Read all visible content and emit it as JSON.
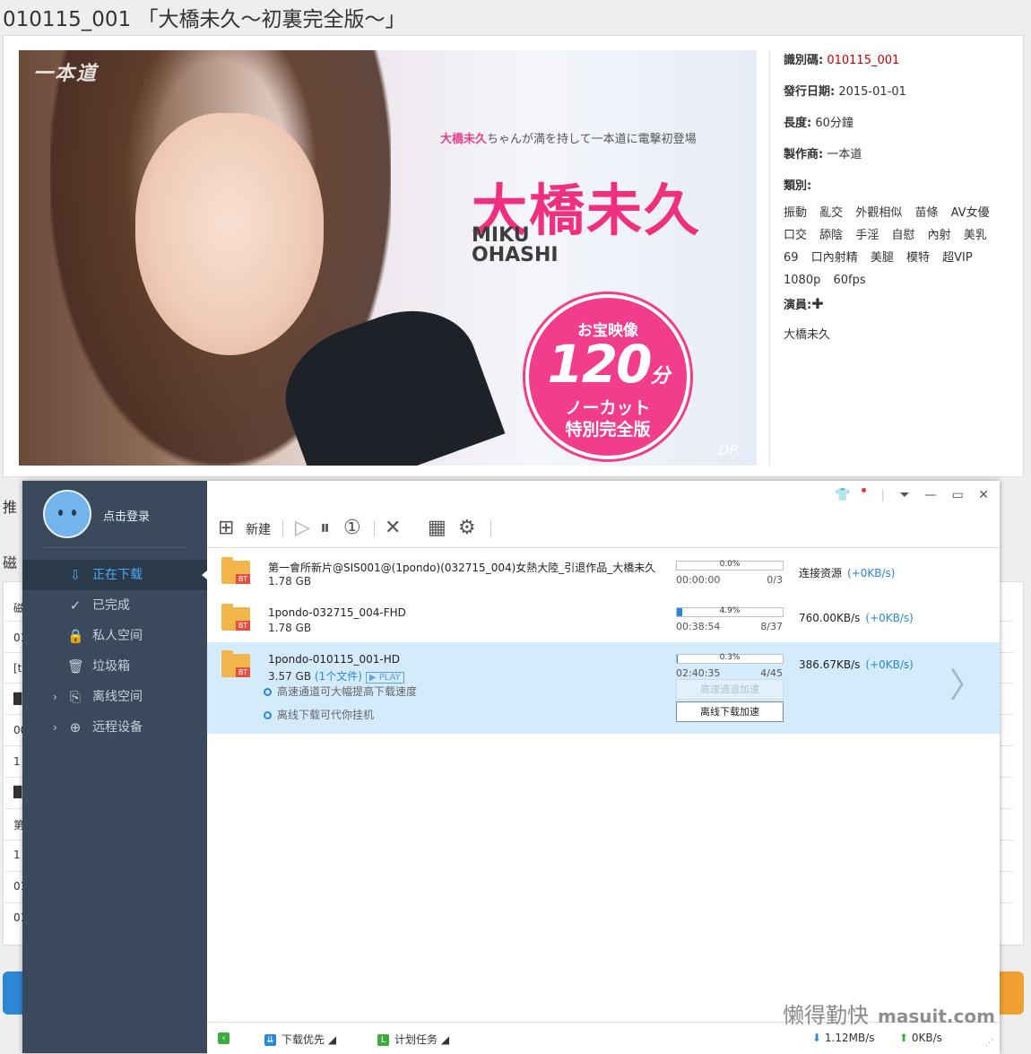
{
  "page": {
    "title": "010115_001 「大橋未久〜初裏完全版〜」",
    "bg_fragments": [
      "推",
      "磁",
      "磁",
      "01",
      "[t",
      "█",
      "00",
      "1",
      "█",
      "第",
      "1",
      "01",
      "01"
    ]
  },
  "cover": {
    "logo": "一本道",
    "tagline_name": "大橋未久",
    "tagline_rest": "ちゃんが満を持して一本道に電撃初登場",
    "name_jp": "大橋未久",
    "name_en": "MIKU\nOHASHI",
    "badge": {
      "line1": "お宝映像",
      "minutes": "120",
      "unit": "分",
      "line3": "ノーカット",
      "line4": "特別完全版"
    },
    "watermark": "DP."
  },
  "info": {
    "id_label": "識別碼:",
    "id_value": "010115_001",
    "date_label": "發行日期:",
    "date_value": "2015-01-01",
    "length_label": "長度:",
    "length_value": "60分鐘",
    "maker_label": "製作商:",
    "maker_value": "一本道",
    "genre_label": "類別:",
    "genres": [
      "振動",
      "亂交",
      "外觀相似",
      "苗條",
      "AV女優",
      "口交",
      "舔陰",
      "手淫",
      "自慰",
      "內射",
      "美乳",
      "69",
      "口內射精",
      "美腿",
      "模特",
      "超VIP",
      "1080p",
      "60fps"
    ],
    "cast_label": "演員:",
    "cast_add": "✚",
    "cast": [
      "大橋未久"
    ]
  },
  "downloader": {
    "login_text": "点击登录",
    "nav": [
      {
        "label": "正在下载",
        "icon": "⇩",
        "active": true,
        "expand": ""
      },
      {
        "label": "已完成",
        "icon": "✓",
        "active": false,
        "expand": ""
      },
      {
        "label": "私人空间",
        "icon": "🔒",
        "active": false,
        "expand": ""
      },
      {
        "label": "垃圾箱",
        "icon": "🗑",
        "active": false,
        "expand": ""
      },
      {
        "label": "离线空间",
        "icon": "⎘",
        "active": false,
        "expand": "›"
      },
      {
        "label": "远程设备",
        "icon": "⊕",
        "active": false,
        "expand": "›"
      }
    ],
    "toolbar": {
      "new_label": "新建"
    },
    "window_controls": {
      "skin": "👕",
      "menu": "⏷",
      "minimize": "—",
      "maximize": "▭",
      "close": "✕"
    },
    "tasks": [
      {
        "name": "第一會所新片@SIS001@(1pondo)(032715_004)女熱大陸_引退作品_大橋未久",
        "size": "1.78 GB",
        "files": "",
        "play": "",
        "progress": 0.0,
        "progress_label": "0.0%",
        "time": "00:00:00",
        "count": "0/3",
        "speed": "连接资源",
        "accel": "(+0KB/s)"
      },
      {
        "name": "1pondo-032715_004-FHD",
        "size": "1.78 GB",
        "files": "",
        "play": "",
        "progress": 4.9,
        "progress_label": "4.9%",
        "time": "00:38:54",
        "count": "8/37",
        "speed": "760.00KB/s",
        "accel": "(+0KB/s)"
      },
      {
        "name": "1pondo-010115_001-HD",
        "size": "3.57 GB",
        "files": "(1个文件)",
        "play": "PLAY",
        "progress": 0.3,
        "progress_label": "0.3%",
        "time": "02:40:35",
        "count": "4/45",
        "speed": "386.67KB/s",
        "accel": "(+0KB/s)"
      }
    ],
    "selected_hints": [
      "高速通道可大幅提高下载速度",
      "离线下载可代你挂机"
    ],
    "selected_buttons": {
      "high_speed": "高速通道加速",
      "offline": "离线下载加速"
    },
    "status": {
      "priority": "下载优先",
      "schedule": "计划任务",
      "down_speed": "1.12MB/s",
      "up_speed": "0KB/s"
    }
  },
  "watermark": {
    "cn": "懒得勤快",
    "en": "masuit.com"
  },
  "colors": {
    "accent": "#2a86d8",
    "sidebar": "#3a4a5c",
    "pink": "#f0307e",
    "selected_row": "#d4ebfb"
  }
}
